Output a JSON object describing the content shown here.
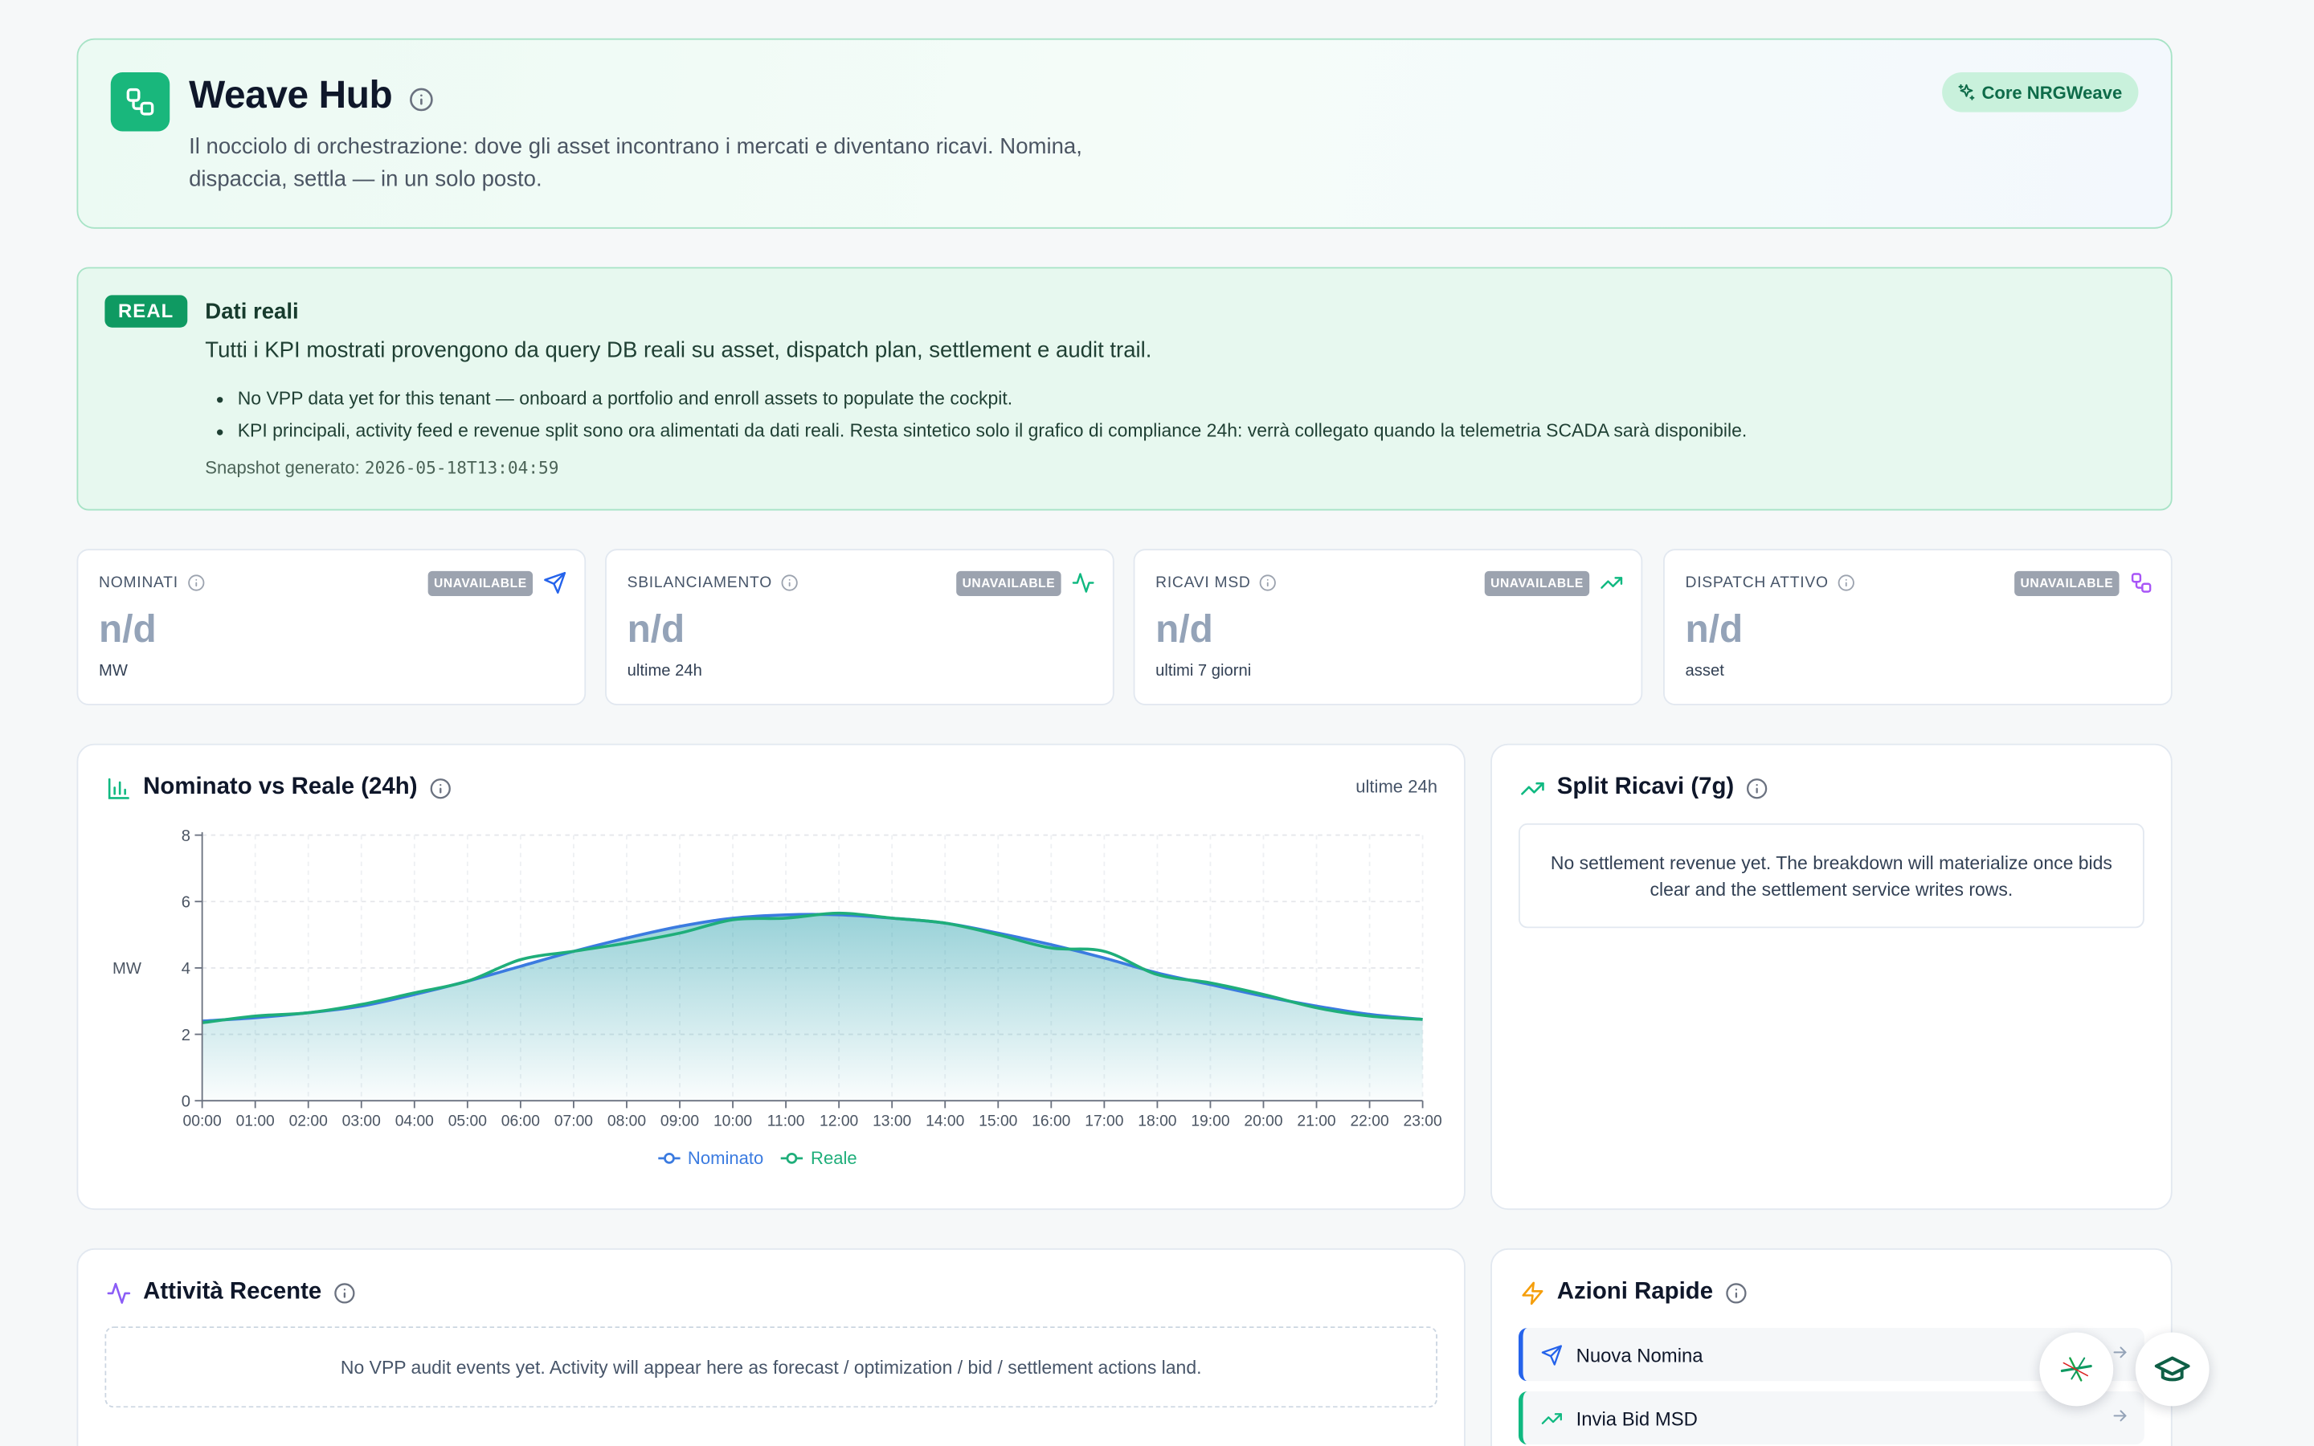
{
  "header": {
    "title": "Weave Hub",
    "description": "Il nocciolo di orchestrazione: dove gli asset incontrano i mercati e diventano ricavi. Nomina, dispaccia, settla — in un solo posto.",
    "badge": "Core NRGWeave",
    "logo_icon": "workflow-icon"
  },
  "real_data": {
    "badge": "REAL",
    "title": "Dati reali",
    "description": "Tutti i KPI mostrati provengono da query DB reali su asset, dispatch plan, settlement e audit trail.",
    "notes": [
      "No VPP data yet for this tenant — onboard a portfolio and enroll assets to populate the cockpit.",
      "KPI principali, activity feed e revenue split sono ora alimentati da dati reali. Resta sintetico solo il grafico di compliance 24h: verrà collegato quando la telemetria SCADA sarà disponibile."
    ],
    "snapshot_label": "Snapshot generato:",
    "snapshot_value": "2026-05-18T13:04:59"
  },
  "kpis": [
    {
      "label": "NOMINATI",
      "badge": "UNAVAILABLE",
      "value": "n/d",
      "sub": "MW",
      "icon": "send-icon",
      "color": "#2563eb"
    },
    {
      "label": "SBILANCIAMENTO",
      "badge": "UNAVAILABLE",
      "value": "n/d",
      "sub": "ultime 24h",
      "icon": "activity-icon",
      "color": "#10b981"
    },
    {
      "label": "RICAVI MSD",
      "badge": "UNAVAILABLE",
      "value": "n/d",
      "sub": "ultimi 7 giorni",
      "icon": "trending-up-icon",
      "color": "#10b981"
    },
    {
      "label": "DISPATCH ATTIVO",
      "badge": "UNAVAILABLE",
      "value": "n/d",
      "sub": "asset",
      "icon": "workflow-icon",
      "color": "#a855f7"
    }
  ],
  "chart_panel": {
    "title": "Nominato vs Reale (24h)",
    "note": "ultime 24h"
  },
  "chart_data": {
    "type": "area",
    "ylabel": "MW",
    "ylim": [
      0,
      8
    ],
    "yticks": [
      0,
      2,
      4,
      6,
      8
    ],
    "x": [
      "00:00",
      "01:00",
      "02:00",
      "03:00",
      "04:00",
      "05:00",
      "06:00",
      "07:00",
      "08:00",
      "09:00",
      "10:00",
      "11:00",
      "12:00",
      "13:00",
      "14:00",
      "15:00",
      "16:00",
      "17:00",
      "18:00",
      "19:00",
      "20:00",
      "21:00",
      "22:00",
      "23:00"
    ],
    "grid": true,
    "legend": "bottom-center",
    "series": [
      {
        "name": "Nominato",
        "color": "#3b7be0",
        "values": [
          2.4,
          2.5,
          2.65,
          2.85,
          3.2,
          3.6,
          4.05,
          4.5,
          4.9,
          5.25,
          5.5,
          5.6,
          5.6,
          5.5,
          5.35,
          5.05,
          4.7,
          4.3,
          3.85,
          3.5,
          3.15,
          2.85,
          2.6,
          2.45
        ]
      },
      {
        "name": "Reale",
        "color": "#1fae7a",
        "values": [
          2.35,
          2.55,
          2.65,
          2.9,
          3.25,
          3.6,
          4.25,
          4.5,
          4.75,
          5.05,
          5.45,
          5.5,
          5.65,
          5.5,
          5.35,
          5.0,
          4.6,
          4.5,
          3.8,
          3.55,
          3.2,
          2.8,
          2.55,
          2.45
        ]
      }
    ]
  },
  "revenue_panel": {
    "title": "Split Ricavi (7g)",
    "empty": "No settlement revenue yet. The breakdown will materialize once bids clear and the settlement service writes rows."
  },
  "activity_panel": {
    "title": "Attività Recente",
    "empty": "No VPP audit events yet. Activity will appear here as forecast / optimization / bid / settlement actions land."
  },
  "actions_panel": {
    "title": "Azioni Rapide",
    "items": [
      {
        "label": "Nuova Nomina",
        "icon": "send-icon",
        "color": "#2563eb"
      },
      {
        "label": "Invia Bid MSD",
        "icon": "trending-up-icon",
        "color": "#10b981"
      }
    ]
  },
  "fabs": [
    {
      "icon": "sparkle-icon"
    },
    {
      "icon": "graduation-cap-icon"
    }
  ]
}
